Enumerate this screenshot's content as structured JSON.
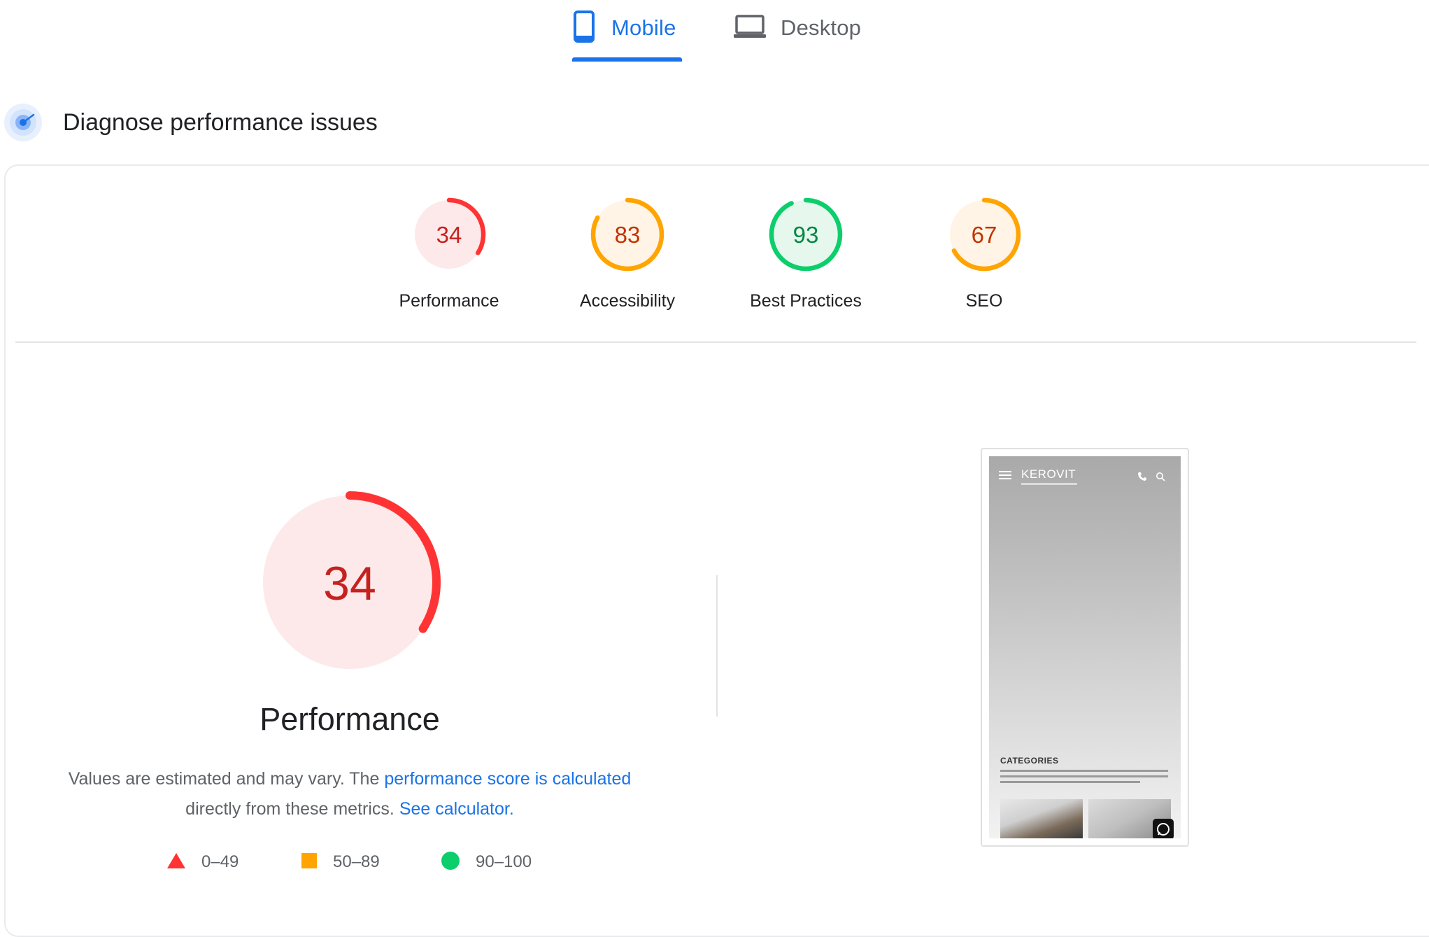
{
  "tabs": [
    {
      "label": "Mobile",
      "active": true,
      "icon": "smartphone-icon"
    },
    {
      "label": "Desktop",
      "active": false,
      "icon": "laptop-icon"
    }
  ],
  "section": {
    "title": "Diagnose performance issues",
    "icon": "diagnose-icon"
  },
  "colors": {
    "accent": "#1a73e8",
    "fail": "#f33",
    "fail_bg": "#fde9ea",
    "fail_text": "#c5221f",
    "average": "#ffa400",
    "average_bg": "#fff4e5",
    "average_text": "#c33300",
    "pass": "#0cce6b",
    "pass_bg": "#e6f7ee",
    "pass_text": "#018642"
  },
  "scores": [
    {
      "label": "Performance",
      "value": "34",
      "level": "fail"
    },
    {
      "label": "Accessibility",
      "value": "83",
      "level": "average"
    },
    {
      "label": "Best Practices",
      "value": "93",
      "level": "pass"
    },
    {
      "label": "SEO",
      "value": "67",
      "level": "average"
    }
  ],
  "main": {
    "score": "34",
    "title": "Performance",
    "desc_before": "Values are estimated and may vary. The ",
    "desc_link1": "performance score is calculated",
    "desc_middle": " directly from these metrics. ",
    "desc_link2": "See calculator."
  },
  "legend": [
    {
      "range": "0–49",
      "shape": "triangle"
    },
    {
      "range": "50–89",
      "shape": "square"
    },
    {
      "range": "90–100",
      "shape": "circle"
    }
  ],
  "screenshot": {
    "brand": "KEROVIT",
    "section_heading": "CATEGORIES"
  }
}
